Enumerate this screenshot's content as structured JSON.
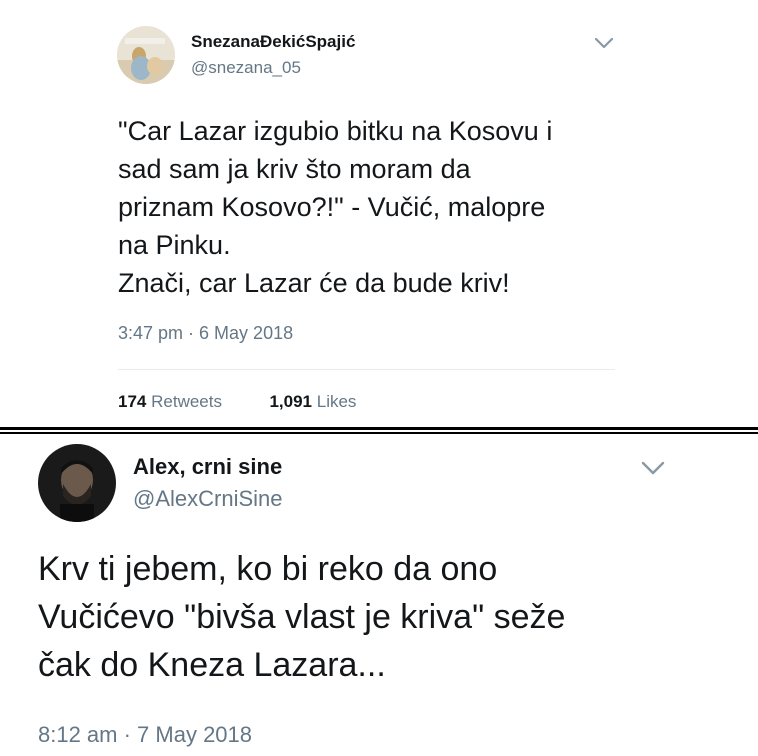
{
  "tweet1": {
    "display_name": "SnezanaĐekićSpajić",
    "handle": "@snezana_05",
    "text": "\"Car Lazar izgubio bitku na Kosovu i\nsad sam ja kriv što moram da\npriznam Kosovo?!\" - Vučić, malopre\nna Pinku.\nZnači, car Lazar će da bude kriv!",
    "timestamp": "3:47 pm · 6 May 2018",
    "retweets_count": "174",
    "retweets_label": "Retweets",
    "likes_count": "1,091",
    "likes_label": "Likes"
  },
  "tweet2": {
    "display_name": "Alex, crni sine",
    "handle": "@AlexCrniSine",
    "text": "Krv ti jebem, ko bi reko da ono\nVučićevo \"bivša vlast je kriva\" seže\nčak do Kneza Lazara...",
    "timestamp": "8:12 am · 7 May 2018"
  },
  "icons": {
    "menu": "chevron-down-icon"
  },
  "colors": {
    "primary_text": "#14171a",
    "secondary_text": "#657786",
    "separator": "#e6ecf0",
    "chevron": "#8899a6"
  }
}
